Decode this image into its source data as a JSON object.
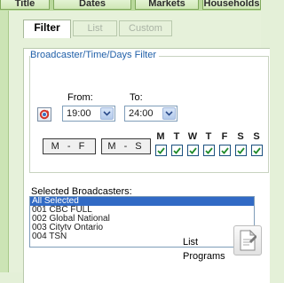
{
  "top_tabs": [
    "Title",
    "Dates",
    "Markets",
    "Households"
  ],
  "sub_tabs": [
    "Filter",
    "List",
    "Custom"
  ],
  "filter": {
    "legend": "Broadcaster/Time/Days Filter",
    "from_label": "From:",
    "to_label": "To:",
    "from_value": "19:00",
    "to_value": "24:00",
    "mf_button": "M - F",
    "ms_button": "M - S",
    "days": [
      "M",
      "T",
      "W",
      "T",
      "F",
      "S",
      "S"
    ],
    "days_checked": [
      true,
      true,
      true,
      true,
      true,
      true,
      true
    ]
  },
  "broadcasters": {
    "label": "Selected Broadcasters:",
    "items": [
      "All Selected",
      "001 CBC FULL",
      "002 Global National",
      "003 Citytv Ontario",
      "004 TSN"
    ],
    "selected_index": 0
  },
  "list_programs": "List Programs",
  "icons": {
    "refresh": "refresh-icon",
    "document": "document-icon",
    "dropdown": "chevron-down-icon",
    "check": "check-icon"
  }
}
